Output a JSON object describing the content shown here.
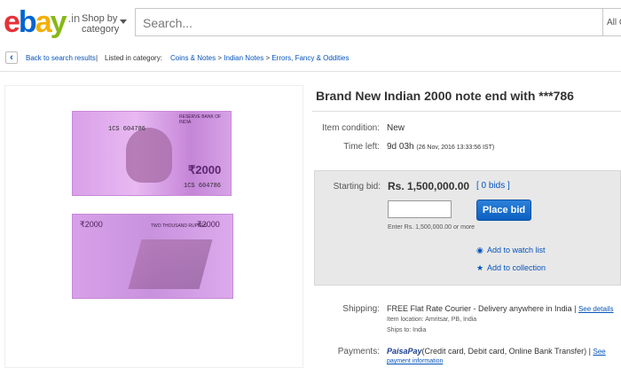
{
  "header": {
    "logo": {
      "e": "e",
      "b": "b",
      "a": "a",
      "y": "y",
      "suffix": ".in"
    },
    "shop_by_1": "Shop by",
    "shop_by_2": "category",
    "search_placeholder": "Search...",
    "category_select": "All C"
  },
  "breadcrumb": {
    "back_label": "Back to search results",
    "separator": "|",
    "listed_in": "Listed in category:",
    "crumbs": [
      "Coins & Notes",
      "Indian Notes",
      "Errors, Fancy & Oddities"
    ],
    "arrow": ">"
  },
  "notes": {
    "front_bank": "RESERVE BANK OF INDIA",
    "front_serial": "1CS 604786",
    "front_serial_2": "1CS 604786",
    "front_value": "₹2000",
    "back_value_left": "₹2000",
    "back_value_right": "₹2000",
    "back_text": "TWO THOUSAND RUPEES"
  },
  "listing": {
    "title": "Brand New Indian 2000 note end with ***786",
    "condition_label": "Item condition:",
    "condition_value": "New",
    "time_label": "Time left:",
    "time_value": "9d 03h",
    "time_detail": "(26 Nov, 2016  13:33:56 IST)",
    "starting_bid_label": "Starting bid:",
    "starting_bid_value": "Rs. 1,500,000.00",
    "bids_link": "[ 0 bids ]",
    "place_bid": "Place bid",
    "bid_hint": "Enter Rs. 1,500,000.00 or more",
    "watch_list": "Add to watch list",
    "collection": "Add to collection",
    "shipping_label": "Shipping:",
    "shipping_value": "FREE  Flat Rate Courier - Delivery anywhere in India |",
    "shipping_link": "See details",
    "item_location": "Item location:  Amritsar, PB, India",
    "ships_to": "Ships to:  India",
    "payments_label": "Payments:",
    "payments_brand": "PaisaPay",
    "payments_value": "(Credit card, Debit card, Online Bank Transfer) |",
    "payments_link_1": "See",
    "payments_link_2": "payment information"
  },
  "colors": {
    "logo_e": "#e53238",
    "logo_b": "#0064d2",
    "logo_a": "#f5af02",
    "logo_y": "#86b817",
    "link": "#0654ba",
    "button": "#0c5fc0"
  }
}
